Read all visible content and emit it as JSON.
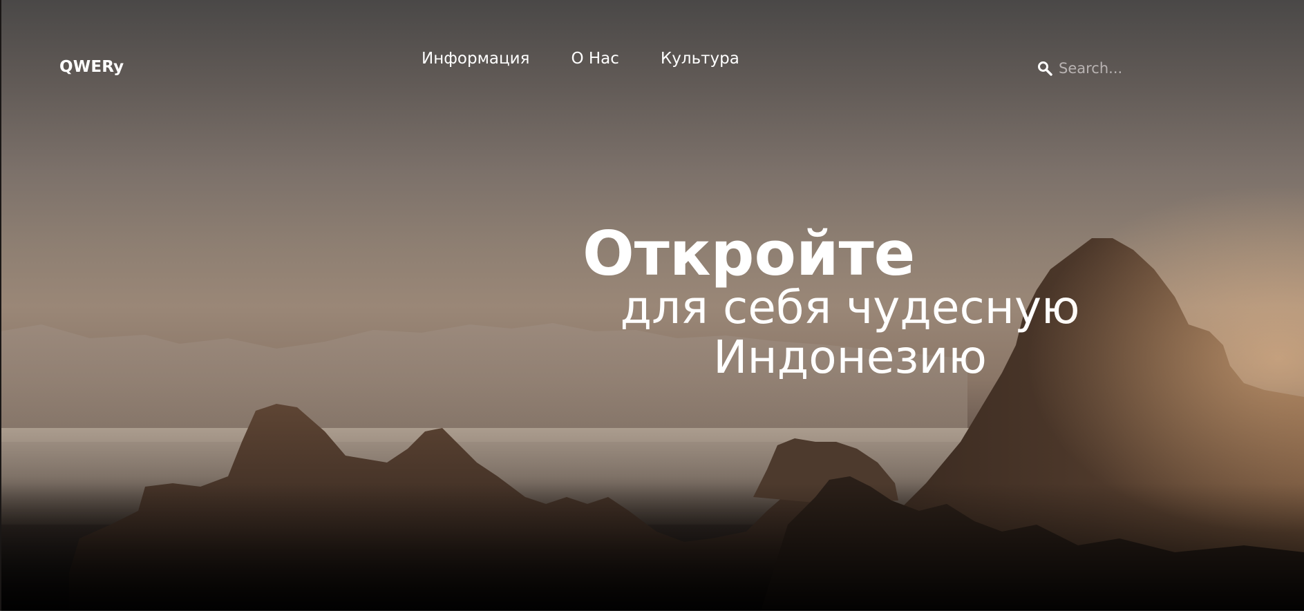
{
  "header": {
    "logo": "QWERy",
    "nav": [
      {
        "label": "Информация"
      },
      {
        "label": "О Нас"
      },
      {
        "label": "Культура"
      }
    ],
    "search": {
      "placeholder": "Search...",
      "value": "",
      "icon": "search-icon"
    }
  },
  "hero": {
    "headline": "Откройте",
    "subline_1": "для себя чудесную",
    "subline_2": "Индонезию"
  }
}
